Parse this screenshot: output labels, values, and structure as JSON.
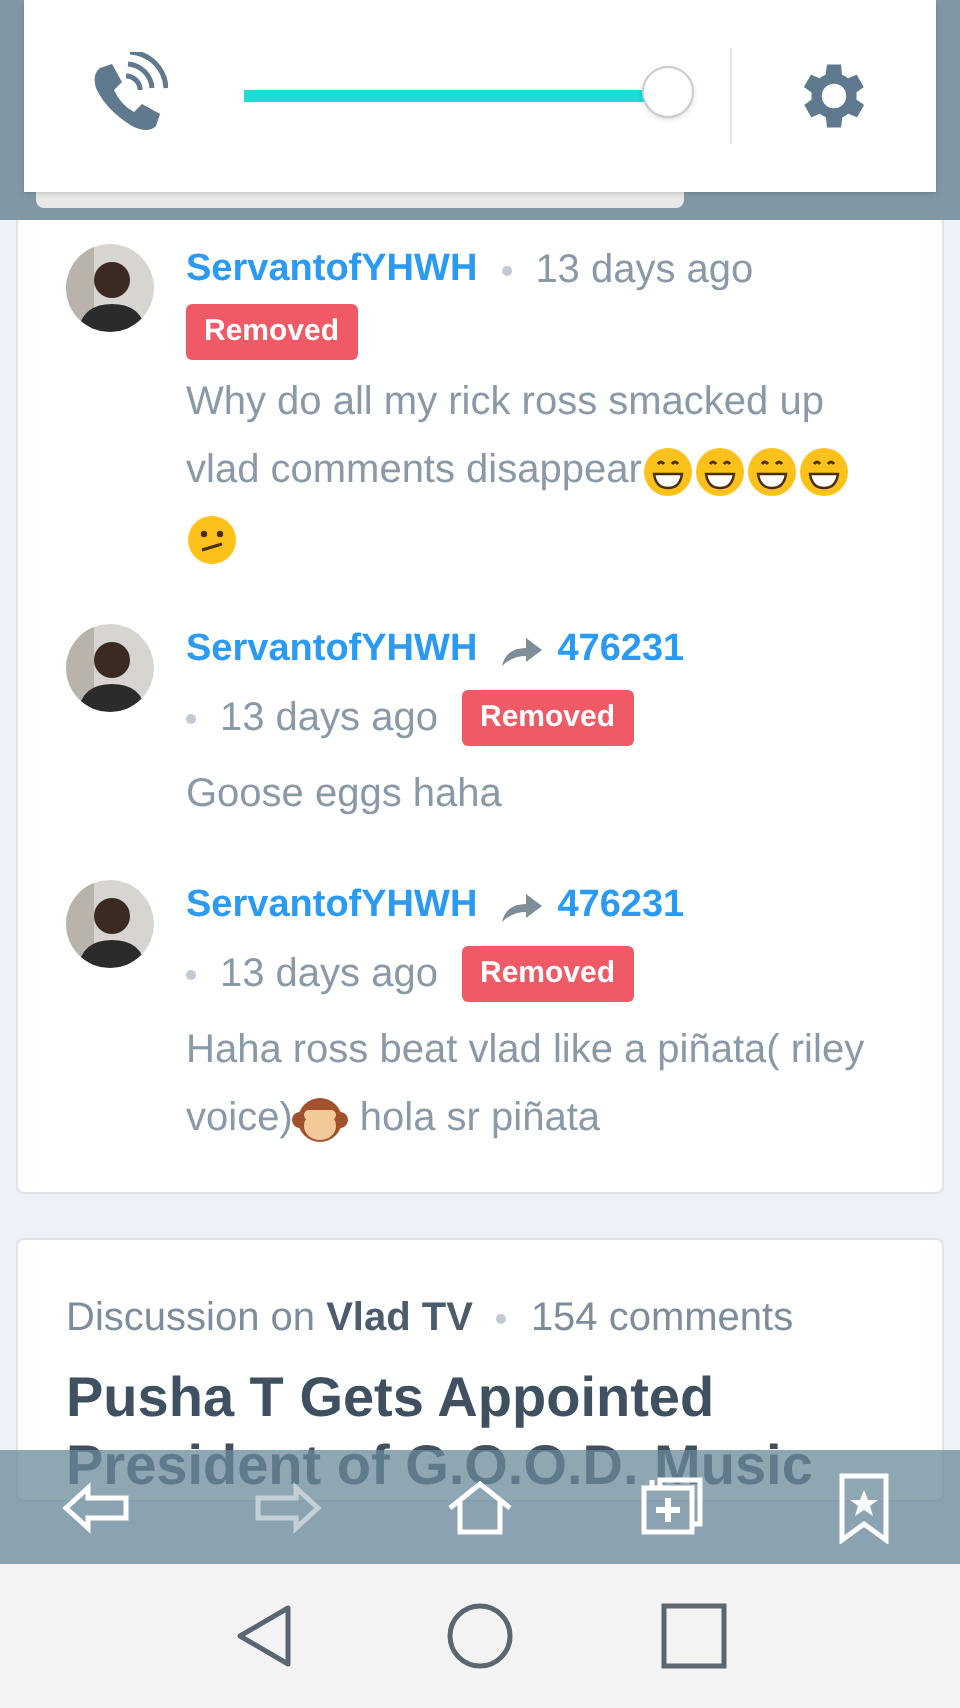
{
  "volume_popup": {
    "level": 0.93
  },
  "comments": [
    {
      "author": "ServantofYHWH",
      "time": "13 days ago",
      "badge": "Removed",
      "body": [
        {
          "kind": "text",
          "text": "Why do all my rick ross smacked up vlad comments disappear"
        },
        {
          "kind": "grin"
        },
        {
          "kind": "grin"
        },
        {
          "kind": "grin"
        },
        {
          "kind": "grin"
        },
        {
          "kind": "confused"
        }
      ]
    },
    {
      "author": "ServantofYHWH",
      "reply_to": "476231",
      "time": "13 days ago",
      "badge": "Removed",
      "body": [
        {
          "kind": "text",
          "text": "Goose eggs haha"
        }
      ]
    },
    {
      "author": "ServantofYHWH",
      "reply_to": "476231",
      "time": "13 days ago",
      "badge": "Removed",
      "body": [
        {
          "kind": "text",
          "text": "Haha ross beat vlad like a piñata( riley voice)"
        },
        {
          "kind": "monkey"
        },
        {
          "kind": "text",
          "text": " hola sr piñata"
        }
      ]
    }
  ],
  "discussion": {
    "prefix": "Discussion on",
    "site": "Vlad TV",
    "count": "154 comments",
    "title": "Pusha T Gets Appointed President of G.O.O.D. Music"
  },
  "browser_toolbar": [
    {
      "kind": "back",
      "disabled": false
    },
    {
      "kind": "forward",
      "disabled": true
    },
    {
      "kind": "home",
      "disabled": false
    },
    {
      "kind": "tabs",
      "disabled": false
    },
    {
      "kind": "bookmark",
      "disabled": false
    }
  ]
}
